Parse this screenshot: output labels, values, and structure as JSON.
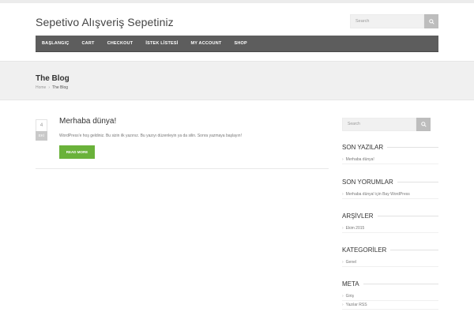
{
  "site": {
    "title": "Sepetivo Alışveriş Sepetiniz"
  },
  "header_search": {
    "placeholder": "Search"
  },
  "nav": {
    "items": [
      "BAŞLANGIÇ",
      "CART",
      "CHECKOUT",
      "İSTEK LİSTESİ",
      "MY ACCOUNT",
      "SHOP"
    ]
  },
  "banner": {
    "title": "The Blog",
    "breadcrumb": {
      "home": "Home",
      "separator": "›",
      "current": "The Blog"
    }
  },
  "post": {
    "date_day": "4",
    "date_month": "EKİ",
    "title": "Merhaba dünya!",
    "excerpt": "WordPress'e hoş geldiniz. Bu sizin ilk yazınız. Bu yazıyı düzenleyin ya da silin. Sonra yazmaya başlayın!",
    "read_more": "READ MORE"
  },
  "sidebar": {
    "search_placeholder": "Search",
    "widgets": [
      {
        "heading": "SON YAZILAR",
        "items": [
          "Merhaba dünya!"
        ]
      },
      {
        "heading": "SON YORUMLAR",
        "items": [
          "Merhaba dünya! için Bay WordPress"
        ]
      },
      {
        "heading": "ARŞİVLER",
        "items": [
          "Ekim 2015"
        ]
      },
      {
        "heading": "KATEGORİLER",
        "items": [
          "Genel"
        ]
      },
      {
        "heading": "META",
        "items": [
          "Giriş",
          "Yazılar RSS"
        ]
      }
    ]
  },
  "colors": {
    "nav_bg": "#5d5d5d",
    "accent_green": "#6ab23a",
    "banner_bg": "#f0f0f0"
  },
  "icons": {
    "search": "magnifier-icon",
    "bullet": "chevron-right-icon"
  }
}
